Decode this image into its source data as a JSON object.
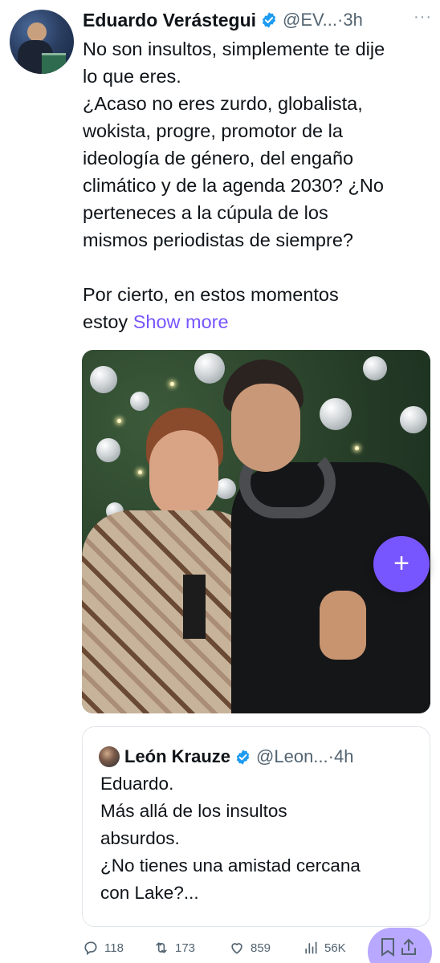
{
  "tweet": {
    "author_name": "Eduardo Verástegui",
    "handle": "@EV...",
    "time": "3h",
    "more": "···",
    "lines": [
      "No son insultos, simplemente te dije",
      "lo que eres.",
      "¿Acaso no eres zurdo, globalista,",
      "wokista, progre, promotor de la",
      "ideología de género, del engaño",
      "climático y de la agenda 2030? ¿No",
      "perteneces a la cúpula de los",
      "mismos periodistas de siempre?",
      "",
      "Por cierto, en estos momentos"
    ],
    "last_line": "estoy",
    "show_more": "Show more"
  },
  "fab": {
    "label": "+"
  },
  "quote": {
    "author_name": "León Krauze",
    "handle": "@Leon...",
    "time": "4h",
    "lines": [
      "Eduardo.",
      "Más allá de los insultos",
      "absurdos.",
      "¿No tienes una amistad cercana",
      "con Lake?..."
    ]
  },
  "actions": {
    "replies": "118",
    "reposts": "173",
    "likes": "859",
    "views": "56K"
  },
  "colors": {
    "accent": "#7856ff",
    "verified": "#1d9bf0",
    "muted": "#536471"
  },
  "icons": [
    "more-icon",
    "verified-badge-icon",
    "reply-icon",
    "repost-icon",
    "like-icon",
    "views-icon",
    "bookmark-icon",
    "share-icon",
    "plus-icon"
  ]
}
